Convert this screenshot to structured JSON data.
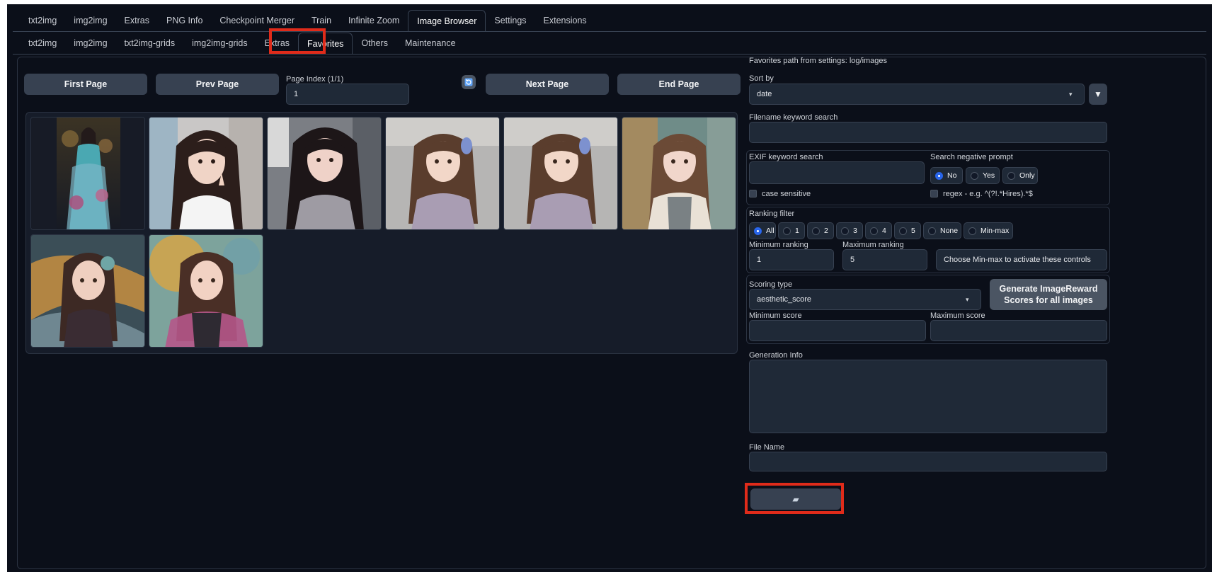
{
  "main_tabs": [
    "txt2img",
    "img2img",
    "Extras",
    "PNG Info",
    "Checkpoint Merger",
    "Train",
    "Infinite Zoom",
    "Image Browser",
    "Settings",
    "Extensions"
  ],
  "main_tab_active": "Image Browser",
  "sub_tabs": [
    "txt2img",
    "img2img",
    "txt2img-grids",
    "img2img-grids",
    "Extras",
    "Favorites",
    "Others",
    "Maintenance"
  ],
  "sub_tab_active": "Favorites",
  "pager": {
    "first": "First Page",
    "prev": "Prev Page",
    "index_label": "Page Index (1/1)",
    "index_value": "1",
    "next": "Next Page",
    "end": "End Page",
    "refresh_icon": "refresh-icon"
  },
  "gallery": {
    "images": [
      {
        "name": "ornate-costume-girl"
      },
      {
        "name": "girl-peace-sign"
      },
      {
        "name": "girl-long-black-hair"
      },
      {
        "name": "girl-blue-bow"
      },
      {
        "name": "girl-blue-bow-copy"
      },
      {
        "name": "girl-grey-top"
      },
      {
        "name": "painted-girl-swirl"
      },
      {
        "name": "painted-girl-scarf"
      }
    ]
  },
  "right": {
    "favorites_path": "Favorites path from settings: log/images",
    "sort_by_label": "Sort by",
    "sort_by_value": "date",
    "sort_dir_icon": "sort-direction-icon",
    "filename_search_label": "Filename keyword search",
    "exif_search_label": "EXIF keyword search",
    "neg_prompt_label": "Search negative prompt",
    "neg_prompt_options": [
      "No",
      "Yes",
      "Only"
    ],
    "neg_prompt_selected": "No",
    "case_sensitive": "case sensitive",
    "regex": "regex - e.g. ^(?!.*Hires).*$",
    "ranking_filter_label": "Ranking filter",
    "ranking_options": [
      "All",
      "1",
      "2",
      "3",
      "4",
      "5",
      "None",
      "Min-max"
    ],
    "ranking_selected": "All",
    "min_ranking_label": "Minimum ranking",
    "min_ranking_value": "1",
    "max_ranking_label": "Maximum ranking",
    "max_ranking_value": "5",
    "minmax_hint": "Choose Min-max to activate these controls",
    "scoring_type_label": "Scoring type",
    "scoring_type_value": "aesthetic_score",
    "generate_button_line1": "Generate ImageReward",
    "generate_button_line2": "Scores for all images",
    "min_score_label": "Minimum score",
    "max_score_label": "Maximum score",
    "generation_info_label": "Generation Info",
    "file_name_label": "File Name",
    "open_folder_icon": "folder-icon"
  },
  "colors": {
    "background": "#0b0f19",
    "panel": "#1f2937",
    "button": "#374151",
    "accent": "#2563eb",
    "highlight": "#e02b1a"
  }
}
